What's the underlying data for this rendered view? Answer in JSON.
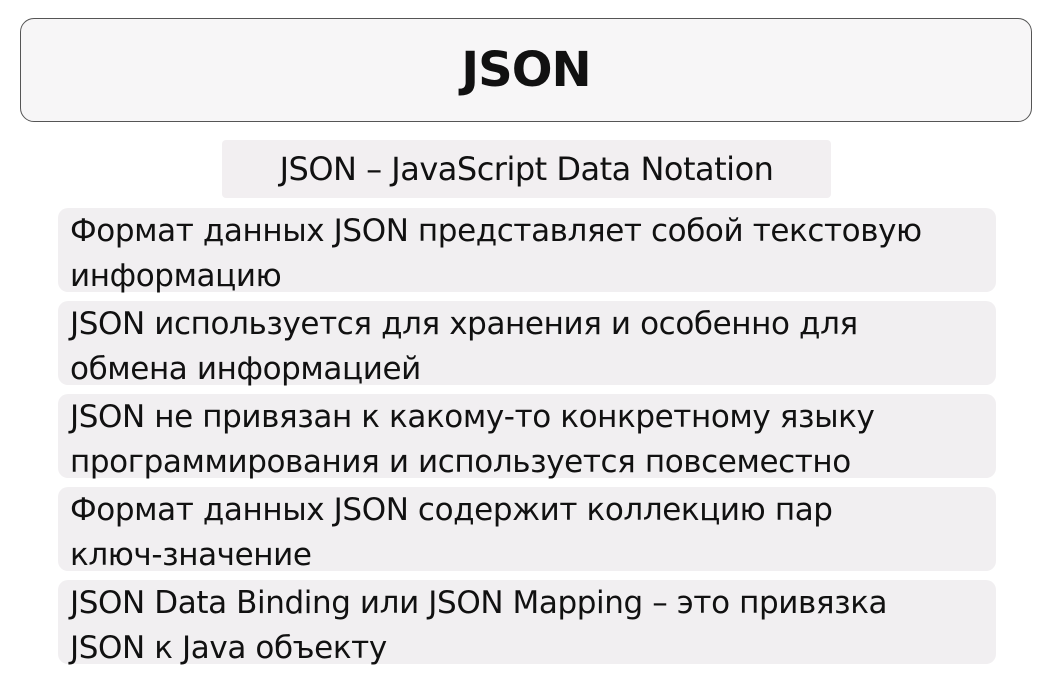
{
  "slide": {
    "title": "JSON",
    "subtitle": "JSON – JavaScript Data Notation",
    "items": [
      {
        "text": "Формат данных JSON представляет собой текстовую\nинформацию"
      },
      {
        "text": "JSON используется для хранения и особенно для\nобмена информацией"
      },
      {
        "text": "JSON не привязан к какому-то конкретному языку\nпрограммирования и используется повсеместно"
      },
      {
        "text": "Формат данных JSON содержит коллекцию пар\nключ-значение"
      },
      {
        "text": "JSON Data Binding или JSON Mapping – это привязка\nJSON к Java объекту"
      }
    ]
  }
}
